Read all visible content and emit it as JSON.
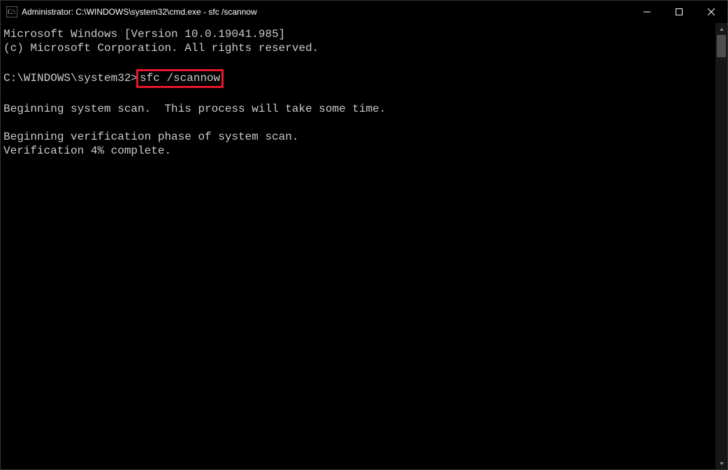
{
  "window": {
    "title": "Administrator: C:\\WINDOWS\\system32\\cmd.exe - sfc  /scannow"
  },
  "terminal": {
    "line_version": "Microsoft Windows [Version 10.0.19041.985]",
    "line_copyright": "(c) Microsoft Corporation. All rights reserved.",
    "prompt": "C:\\WINDOWS\\system32>",
    "command": "sfc /scannow",
    "line_begin_scan": "Beginning system scan.  This process will take some time.",
    "line_begin_verify": "Beginning verification phase of system scan.",
    "line_verify_progress": "Verification 4% complete."
  }
}
